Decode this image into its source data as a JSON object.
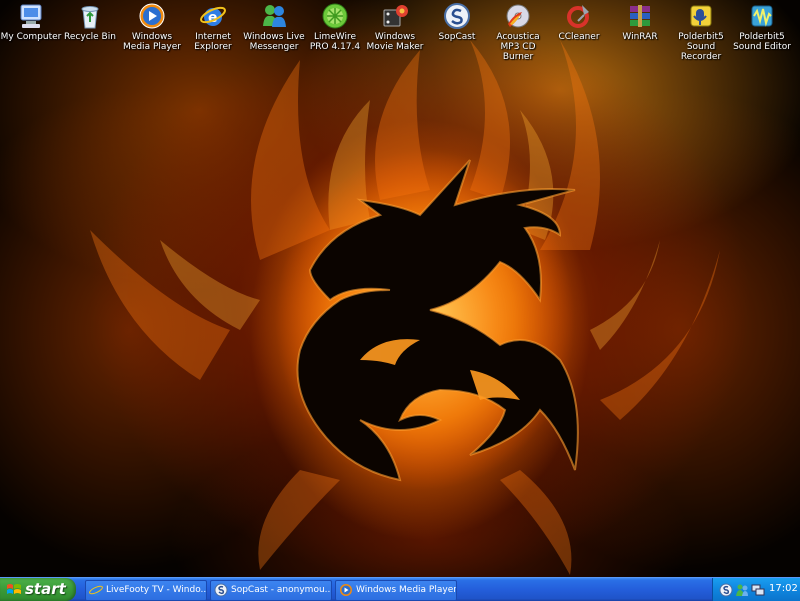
{
  "desktop": {
    "icons": [
      {
        "label": "My Computer",
        "icon": "my-computer-icon"
      },
      {
        "label": "Recycle Bin",
        "icon": "recycle-bin-icon"
      },
      {
        "label": "Windows Media Player",
        "icon": "windows-media-player-icon"
      },
      {
        "label": "Internet Explorer",
        "icon": "internet-explorer-icon"
      },
      {
        "label": "Windows Live Messenger",
        "icon": "messenger-icon"
      },
      {
        "label": "LimeWire PRO 4.17.4",
        "icon": "limewire-icon"
      },
      {
        "label": "Windows Movie Maker",
        "icon": "movie-maker-icon"
      },
      {
        "label": "SopCast",
        "icon": "sopcast-icon"
      },
      {
        "label": "Acoustica MP3 CD Burner",
        "icon": "cd-burner-icon"
      },
      {
        "label": "CCleaner",
        "icon": "ccleaner-icon"
      },
      {
        "label": "WinRAR",
        "icon": "winrar-icon"
      },
      {
        "label": "Polderbit5 Sound Recorder",
        "icon": "sound-recorder-icon"
      },
      {
        "label": "Polderbit5 Sound Editor",
        "icon": "sound-editor-icon"
      }
    ]
  },
  "taskbar": {
    "start_label": "start",
    "tasks": [
      {
        "label": "LiveFooty TV - Windo...",
        "icon": "ie-icon"
      },
      {
        "label": "SopCast - anonymou...",
        "icon": "sopcast-icon"
      },
      {
        "label": "Windows Media Player",
        "icon": "media-player-icon"
      }
    ],
    "tray": {
      "clock": "17:02",
      "icons": [
        "sopcast-tray-icon",
        "messenger-tray-icon",
        "network-tray-icon"
      ]
    }
  },
  "colors": {
    "taskbar_blue": "#245edb",
    "start_green": "#3a9a38",
    "tray_blue": "#0f86df",
    "fire_orange": "#ff8a10"
  }
}
